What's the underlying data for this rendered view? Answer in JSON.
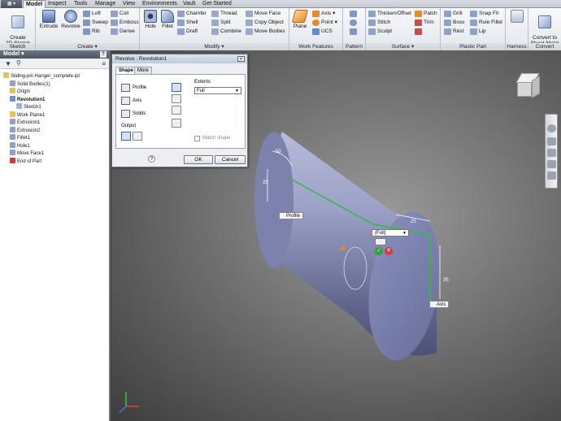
{
  "app": {
    "menu_icon": "inventor-app-icon"
  },
  "tabs": [
    "Model",
    "Inspect",
    "Tools",
    "Manage",
    "View",
    "Environments",
    "Vault",
    "Get Started"
  ],
  "ribbon": {
    "sketch_group": {
      "label": "Sketch",
      "create_2d_sketch": "Create\n2D Sketch"
    },
    "create_group": {
      "label": "Create ▾",
      "extrude": "Extrude",
      "revolve": "Revolve",
      "loft": "Loft",
      "sweep": "Sweep",
      "rib": "Rib",
      "coil": "Coil",
      "emboss": "Emboss",
      "derive": "Derive"
    },
    "modify_group": {
      "label": "Modify ▾",
      "hole": "Hole",
      "fillet": "Fillet",
      "chamfer": "Chamfer",
      "shell": "Shell",
      "draft": "Draft",
      "thread": "Thread",
      "split": "Split",
      "combine": "Combine",
      "move_face": "Move Face",
      "copy_object": "Copy Object",
      "move_bodies": "Move Bodies"
    },
    "work_features_group": {
      "label": "Work Features",
      "plane": "Plane",
      "axis": "Axis ▾",
      "point": "Point ▾",
      "ucs": "UCS"
    },
    "pattern_group": {
      "label": "Pattern"
    },
    "surface_group": {
      "label": "Surface ▾",
      "thicken_offset": "Thicken/Offset",
      "stitch": "Stitch",
      "sculpt": "Sculpt",
      "patch": "Patch",
      "trim": "Trim"
    },
    "plastic_part_group": {
      "label": "Plastic Part",
      "grill": "Grill",
      "boss": "Boss",
      "rest": "Rest",
      "snap_fit": "Snap Fit",
      "rule_fillet": "Rule Fillet",
      "lip": "Lip"
    },
    "harness_group": {
      "label": "Harness"
    },
    "convert_group": {
      "label": "Convert",
      "convert_to_sheet_metal": "Convert to\nSheet Metal"
    }
  },
  "browser": {
    "title": "Model ▾",
    "items": [
      {
        "label": "Sliding-pin Hanger_complete.ipt",
        "indent": 0,
        "bold": false
      },
      {
        "label": "Solid Bodies(1)",
        "indent": 1,
        "bold": false
      },
      {
        "label": "Origin",
        "indent": 1,
        "bold": false
      },
      {
        "label": "Revolution1",
        "indent": 1,
        "bold": true
      },
      {
        "label": "Sketch1",
        "indent": 2,
        "bold": false
      },
      {
        "label": "Work Plane1",
        "indent": 1,
        "bold": false
      },
      {
        "label": "Extrusion1",
        "indent": 1,
        "bold": false
      },
      {
        "label": "Extrusion2",
        "indent": 1,
        "bold": false
      },
      {
        "label": "Fillet1",
        "indent": 1,
        "bold": false
      },
      {
        "label": "Hole1",
        "indent": 1,
        "bold": false
      },
      {
        "label": "Move Face1",
        "indent": 1,
        "bold": false
      },
      {
        "label": "End of Part",
        "indent": 1,
        "bold": false
      }
    ]
  },
  "dialog": {
    "title": "Revolve : Revolution1",
    "tab_shape": "Shape",
    "tab_more": "More",
    "profile": "Profile",
    "axis": "Axis",
    "solids": "Solids",
    "output": "Output",
    "extents_label": "Extents",
    "extents_value": "Full",
    "match_shape": "Match shape",
    "ok": "OK",
    "cancel": "Cancel"
  },
  "viewport": {
    "dim_50": "50",
    "dim_25a": "25",
    "dim_25b": "25",
    "dim_35": "35",
    "profile_tag": "Profile",
    "axis_tag": "Axis",
    "minitoolbar_value": "(Full)"
  },
  "colors": {
    "tab_active": "#f4f6f8",
    "browser_header": "#4c535d",
    "profile_line": "#2fbf3a",
    "solid_body": "#8a90bd"
  }
}
